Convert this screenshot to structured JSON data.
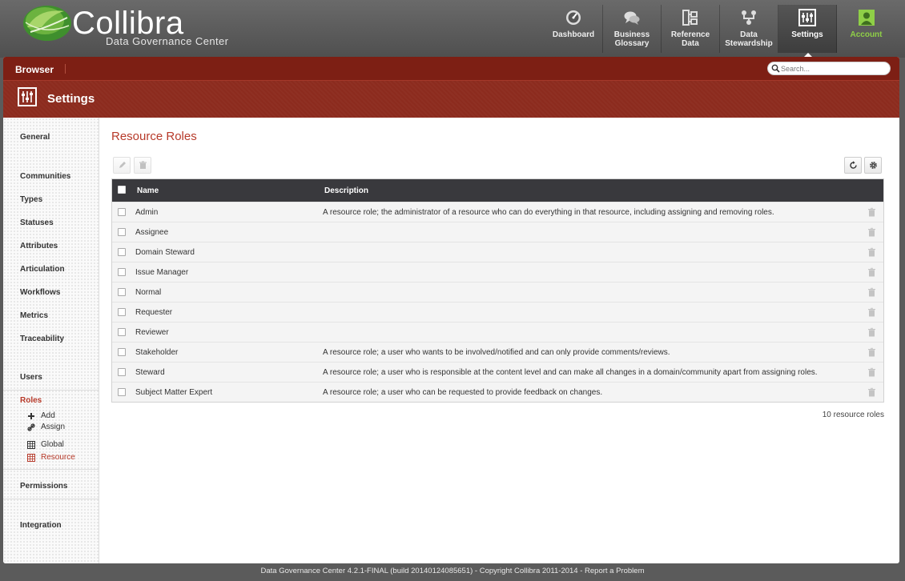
{
  "brand": {
    "name": "Collibra",
    "subtitle": "Data Governance Center"
  },
  "nav": [
    {
      "label": "Dashboard",
      "icon": "dashboard-icon"
    },
    {
      "label": "Business\nGlossary",
      "icon": "chat-bubbles-icon"
    },
    {
      "label": "Reference\nData",
      "icon": "reference-data-icon"
    },
    {
      "label": "Data\nStewardship",
      "icon": "stewardship-icon"
    },
    {
      "label": "Settings",
      "icon": "sliders-icon",
      "active": true
    },
    {
      "label": "Account",
      "icon": "user-icon",
      "color": "#8fcf47"
    }
  ],
  "browser_bar": {
    "label": "Browser",
    "search_placeholder": "Search..."
  },
  "settings_bar": {
    "title": "Settings"
  },
  "sidebar": {
    "items": [
      "General",
      "Communities",
      "Types",
      "Statuses",
      "Attributes",
      "Articulation",
      "Workflows",
      "Metrics",
      "Traceability",
      "Users",
      "Roles",
      "Permissions",
      "Integration"
    ],
    "roles_sub": [
      {
        "label": "Add",
        "icon": "plus-icon"
      },
      {
        "label": "Assign",
        "icon": "link-icon"
      },
      {
        "label": "Global",
        "icon": "table-icon"
      },
      {
        "label": "Resource",
        "icon": "table-icon"
      }
    ]
  },
  "main": {
    "title": "Resource Roles",
    "columns": {
      "name": "Name",
      "description": "Description"
    },
    "rows": [
      {
        "name": "Admin",
        "description": "A resource role; the administrator of a resource who can do everything in that resource, including assigning and removing roles."
      },
      {
        "name": "Assignee",
        "description": ""
      },
      {
        "name": "Domain Steward",
        "description": ""
      },
      {
        "name": "Issue Manager",
        "description": ""
      },
      {
        "name": "Normal",
        "description": ""
      },
      {
        "name": "Requester",
        "description": ""
      },
      {
        "name": "Reviewer",
        "description": ""
      },
      {
        "name": "Stakeholder",
        "description": "A resource role; a user who wants to be involved/notified and can only provide comments/reviews."
      },
      {
        "name": "Steward",
        "description": "A resource role; a user who is responsible at the content level and can make all changes in a domain/community apart from assigning roles."
      },
      {
        "name": "Subject Matter Expert",
        "description": "A resource role; a user who can be requested to provide feedback on changes."
      }
    ],
    "count": "10 resource roles"
  },
  "footer": {
    "text": "Data Governance Center 4.2.1-FINAL (build 20140124085651) - Copyright Collibra 2011-2014 - Report a Problem"
  },
  "colors": {
    "accent": "#b73a2a",
    "header_red": "#8c2b1e",
    "browser_red": "#7d1f14",
    "grid_header": "#39393d"
  }
}
